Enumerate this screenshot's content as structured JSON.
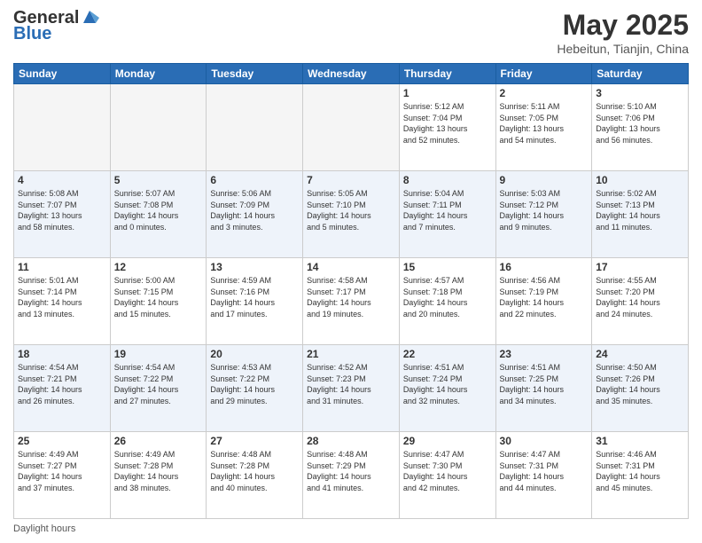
{
  "header": {
    "logo_general": "General",
    "logo_blue": "Blue",
    "month_title": "May 2025",
    "subtitle": "Hebeitun, Tianjin, China"
  },
  "days_of_week": [
    "Sunday",
    "Monday",
    "Tuesday",
    "Wednesday",
    "Thursday",
    "Friday",
    "Saturday"
  ],
  "weeks": [
    [
      {
        "day": "",
        "info": ""
      },
      {
        "day": "",
        "info": ""
      },
      {
        "day": "",
        "info": ""
      },
      {
        "day": "",
        "info": ""
      },
      {
        "day": "1",
        "info": "Sunrise: 5:12 AM\nSunset: 7:04 PM\nDaylight: 13 hours\nand 52 minutes."
      },
      {
        "day": "2",
        "info": "Sunrise: 5:11 AM\nSunset: 7:05 PM\nDaylight: 13 hours\nand 54 minutes."
      },
      {
        "day": "3",
        "info": "Sunrise: 5:10 AM\nSunset: 7:06 PM\nDaylight: 13 hours\nand 56 minutes."
      }
    ],
    [
      {
        "day": "4",
        "info": "Sunrise: 5:08 AM\nSunset: 7:07 PM\nDaylight: 13 hours\nand 58 minutes."
      },
      {
        "day": "5",
        "info": "Sunrise: 5:07 AM\nSunset: 7:08 PM\nDaylight: 14 hours\nand 0 minutes."
      },
      {
        "day": "6",
        "info": "Sunrise: 5:06 AM\nSunset: 7:09 PM\nDaylight: 14 hours\nand 3 minutes."
      },
      {
        "day": "7",
        "info": "Sunrise: 5:05 AM\nSunset: 7:10 PM\nDaylight: 14 hours\nand 5 minutes."
      },
      {
        "day": "8",
        "info": "Sunrise: 5:04 AM\nSunset: 7:11 PM\nDaylight: 14 hours\nand 7 minutes."
      },
      {
        "day": "9",
        "info": "Sunrise: 5:03 AM\nSunset: 7:12 PM\nDaylight: 14 hours\nand 9 minutes."
      },
      {
        "day": "10",
        "info": "Sunrise: 5:02 AM\nSunset: 7:13 PM\nDaylight: 14 hours\nand 11 minutes."
      }
    ],
    [
      {
        "day": "11",
        "info": "Sunrise: 5:01 AM\nSunset: 7:14 PM\nDaylight: 14 hours\nand 13 minutes."
      },
      {
        "day": "12",
        "info": "Sunrise: 5:00 AM\nSunset: 7:15 PM\nDaylight: 14 hours\nand 15 minutes."
      },
      {
        "day": "13",
        "info": "Sunrise: 4:59 AM\nSunset: 7:16 PM\nDaylight: 14 hours\nand 17 minutes."
      },
      {
        "day": "14",
        "info": "Sunrise: 4:58 AM\nSunset: 7:17 PM\nDaylight: 14 hours\nand 19 minutes."
      },
      {
        "day": "15",
        "info": "Sunrise: 4:57 AM\nSunset: 7:18 PM\nDaylight: 14 hours\nand 20 minutes."
      },
      {
        "day": "16",
        "info": "Sunrise: 4:56 AM\nSunset: 7:19 PM\nDaylight: 14 hours\nand 22 minutes."
      },
      {
        "day": "17",
        "info": "Sunrise: 4:55 AM\nSunset: 7:20 PM\nDaylight: 14 hours\nand 24 minutes."
      }
    ],
    [
      {
        "day": "18",
        "info": "Sunrise: 4:54 AM\nSunset: 7:21 PM\nDaylight: 14 hours\nand 26 minutes."
      },
      {
        "day": "19",
        "info": "Sunrise: 4:54 AM\nSunset: 7:22 PM\nDaylight: 14 hours\nand 27 minutes."
      },
      {
        "day": "20",
        "info": "Sunrise: 4:53 AM\nSunset: 7:22 PM\nDaylight: 14 hours\nand 29 minutes."
      },
      {
        "day": "21",
        "info": "Sunrise: 4:52 AM\nSunset: 7:23 PM\nDaylight: 14 hours\nand 31 minutes."
      },
      {
        "day": "22",
        "info": "Sunrise: 4:51 AM\nSunset: 7:24 PM\nDaylight: 14 hours\nand 32 minutes."
      },
      {
        "day": "23",
        "info": "Sunrise: 4:51 AM\nSunset: 7:25 PM\nDaylight: 14 hours\nand 34 minutes."
      },
      {
        "day": "24",
        "info": "Sunrise: 4:50 AM\nSunset: 7:26 PM\nDaylight: 14 hours\nand 35 minutes."
      }
    ],
    [
      {
        "day": "25",
        "info": "Sunrise: 4:49 AM\nSunset: 7:27 PM\nDaylight: 14 hours\nand 37 minutes."
      },
      {
        "day": "26",
        "info": "Sunrise: 4:49 AM\nSunset: 7:28 PM\nDaylight: 14 hours\nand 38 minutes."
      },
      {
        "day": "27",
        "info": "Sunrise: 4:48 AM\nSunset: 7:28 PM\nDaylight: 14 hours\nand 40 minutes."
      },
      {
        "day": "28",
        "info": "Sunrise: 4:48 AM\nSunset: 7:29 PM\nDaylight: 14 hours\nand 41 minutes."
      },
      {
        "day": "29",
        "info": "Sunrise: 4:47 AM\nSunset: 7:30 PM\nDaylight: 14 hours\nand 42 minutes."
      },
      {
        "day": "30",
        "info": "Sunrise: 4:47 AM\nSunset: 7:31 PM\nDaylight: 14 hours\nand 44 minutes."
      },
      {
        "day": "31",
        "info": "Sunrise: 4:46 AM\nSunset: 7:31 PM\nDaylight: 14 hours\nand 45 minutes."
      }
    ]
  ],
  "footer": {
    "daylight_label": "Daylight hours"
  }
}
